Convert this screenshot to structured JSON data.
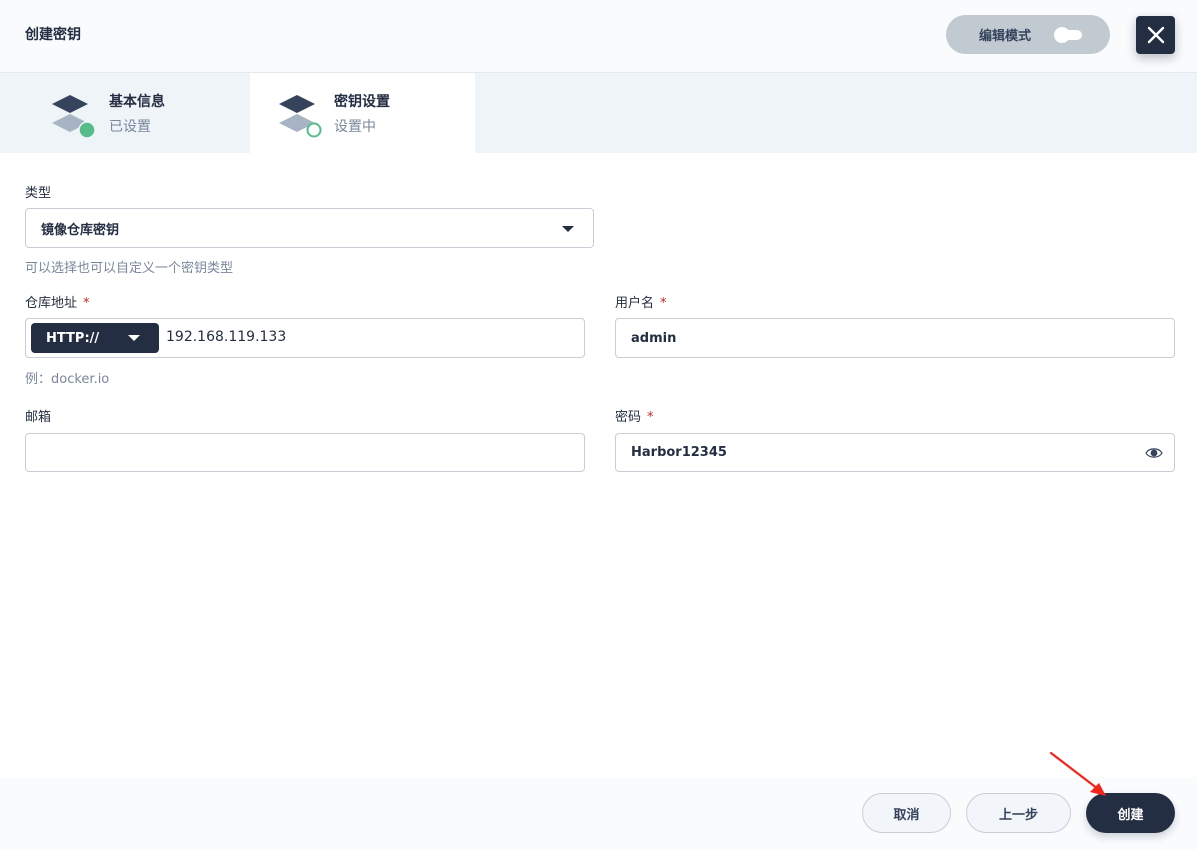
{
  "header": {
    "title": "创建密钥",
    "edit_mode_label": "编辑模式"
  },
  "steps": [
    {
      "title": "基本信息",
      "status": "已设置"
    },
    {
      "title": "密钥设置",
      "status": "设置中"
    }
  ],
  "form": {
    "type": {
      "label": "类型",
      "value": "镜像仓库密钥",
      "hint": "可以选择也可以自定义一个密钥类型"
    },
    "registry": {
      "label": "仓库地址",
      "required_mark": "*",
      "protocol": "HTTP://",
      "value": "192.168.119.133",
      "hint": "例：docker.io"
    },
    "username": {
      "label": "用户名",
      "required_mark": "*",
      "value": "admin"
    },
    "email": {
      "label": "邮箱",
      "value": ""
    },
    "password": {
      "label": "密码",
      "required_mark": "*",
      "value": "Harbor12345"
    }
  },
  "footer": {
    "cancel_label": "取消",
    "prev_label": "上一步",
    "create_label": "创建"
  },
  "colors": {
    "primary_dark": "#242e42",
    "success_green": "#55bc8a",
    "required_red": "#ca2621",
    "annotation_arrow": "#f5241b"
  }
}
